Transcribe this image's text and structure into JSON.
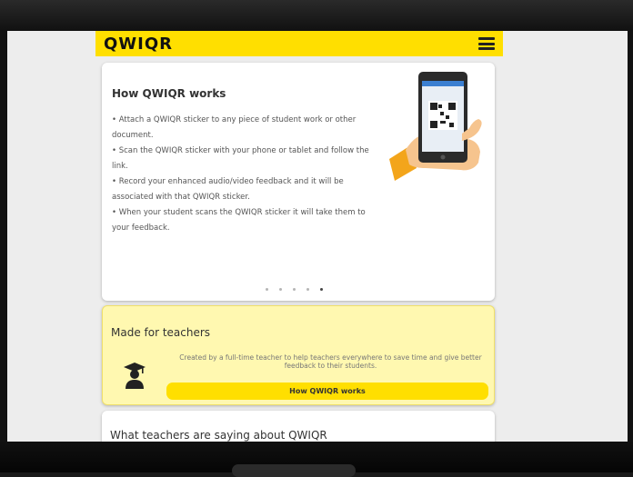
{
  "header": {
    "logo_text": "QWIQR",
    "menu_icon": "hamburger-menu-icon",
    "background_color": "#ffdf00"
  },
  "how_it_works": {
    "title": "How QWIQR works",
    "steps": [
      "Attach a QWIQR sticker to any piece of student work or other document.",
      "Scan the QWIQR sticker with your phone or tablet and follow the link.",
      "Record your enhanced audio/video feedback and it will be associated with that QWIQR sticker.",
      "When your student scans the QWIQR sticker it will take them to your feedback."
    ],
    "illustration_icon": "hand-holding-phone-qr-icon",
    "carousel": {
      "total": 5,
      "active_index": 4
    }
  },
  "made_for_teachers": {
    "title": "Made for teachers",
    "description": "Created by a full-time teacher to help teachers everywhere to save time and give better feedback to their students.",
    "icon": "graduate-teacher-icon",
    "button_label": "How QWIQR works",
    "background_color": "#fff8b0"
  },
  "testimonials": {
    "title": "What teachers are saying about QWIQR"
  }
}
